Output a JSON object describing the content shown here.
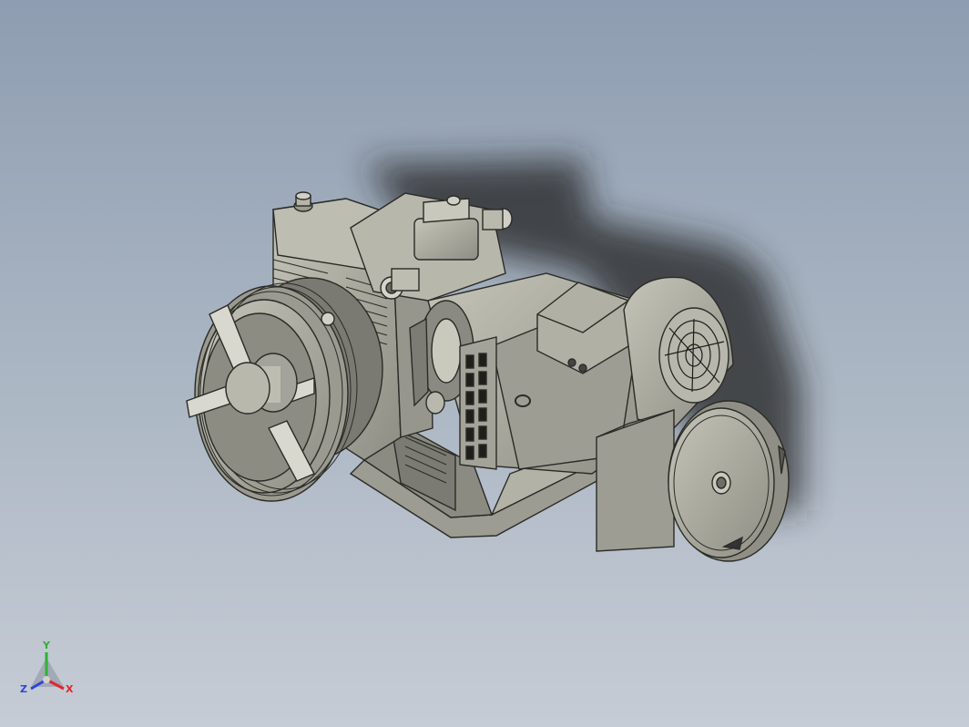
{
  "viewport": {
    "background_top": "#8e9db1",
    "background_bottom": "#c6ccd5",
    "model_color": "#a7a79c"
  },
  "triad": {
    "x_label": "X",
    "y_label": "Y",
    "z_label": "Z",
    "x_color": "#e2262b",
    "y_color": "#2fb232",
    "z_color": "#2f46d8"
  }
}
